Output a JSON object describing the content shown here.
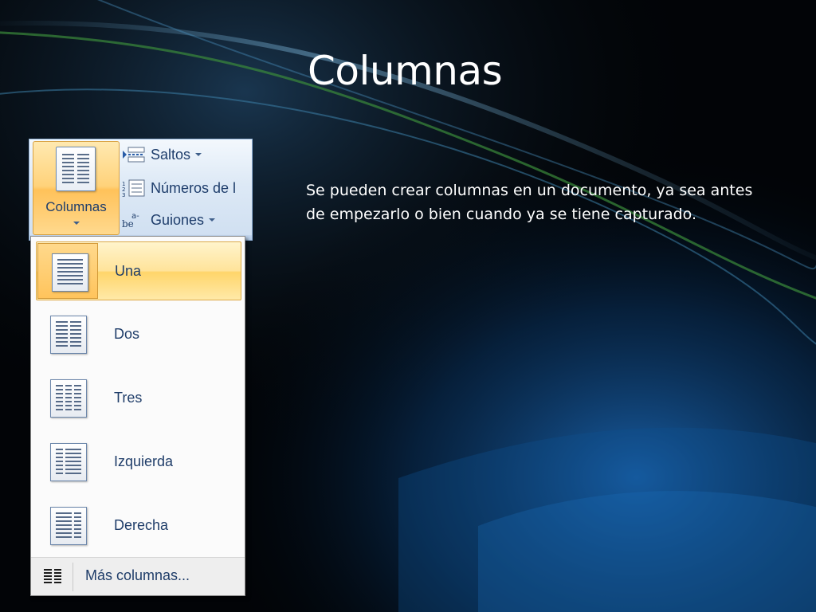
{
  "slide": {
    "title": "Columnas",
    "body": "Se pueden crear columnas en un documento, ya sea antes de empezarlo o bien cuando ya se tiene capturado."
  },
  "ribbon": {
    "columns_button_label": "Columnas",
    "breaks_label": "Saltos",
    "line_numbers_label": "Números de l",
    "hyphenation_label": "Guiones"
  },
  "menu": {
    "items": [
      {
        "label": "Una",
        "icon": "one-column-icon",
        "columns": 1,
        "highlighted": true
      },
      {
        "label": "Dos",
        "icon": "two-columns-icon",
        "columns": 2
      },
      {
        "label": "Tres",
        "icon": "three-columns-icon",
        "columns": 3
      },
      {
        "label": "Izquierda",
        "icon": "left-column-icon",
        "columns": 2
      },
      {
        "label": "Derecha",
        "icon": "right-column-icon",
        "columns": 2
      }
    ],
    "more_label": "Más columnas..."
  },
  "colors": {
    "highlight": "#ffd56a",
    "ribbon_text": "#1e3d6b",
    "title_text": "#ffffff"
  }
}
